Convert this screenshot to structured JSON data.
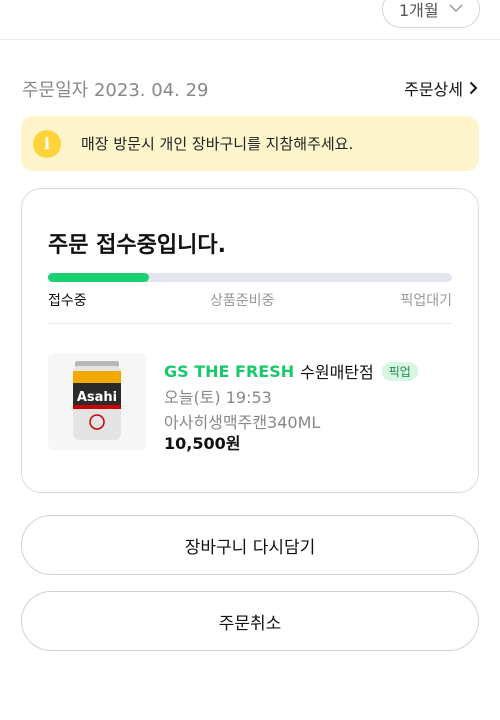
{
  "header": {
    "period_select": "1개월"
  },
  "order": {
    "date_label": "주문일자",
    "date": "2023. 04. 29",
    "detail_link": "주문상세"
  },
  "notice": {
    "text": "매장 방문시 개인 장바구니를 지참해주세요.",
    "icon": "info-icon"
  },
  "status": {
    "title": "주문 접수중입니다.",
    "progress": 0.25,
    "steps": [
      "접수중",
      "상품준비중",
      "픽업대기"
    ],
    "active_step": 0
  },
  "item": {
    "store_brand": "GS THE FRESH",
    "store_branch": "수원매탄점",
    "badge": "픽업",
    "pickup_time": "오늘(토) 19:53",
    "name": "아사히생맥주캔340ML",
    "price": "10,500원",
    "can_text": "Asahi"
  },
  "actions": {
    "reorder": "장바구니 다시담기",
    "cancel": "주문취소"
  },
  "colors": {
    "accent": "#1bd16f",
    "brand": "#19c86a",
    "notice_bg": "#fff5cc",
    "info": "#ffd43b"
  }
}
